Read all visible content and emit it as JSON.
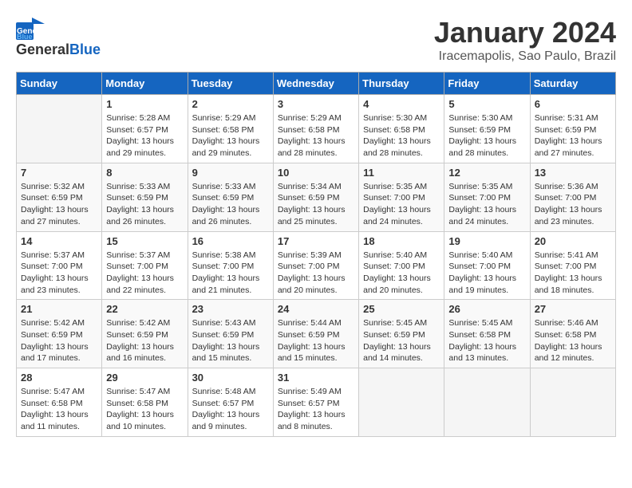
{
  "header": {
    "logo_general": "General",
    "logo_blue": "Blue",
    "month": "January 2024",
    "location": "Iracemapolis, Sao Paulo, Brazil"
  },
  "weekdays": [
    "Sunday",
    "Monday",
    "Tuesday",
    "Wednesday",
    "Thursday",
    "Friday",
    "Saturday"
  ],
  "weeks": [
    [
      {
        "day": "",
        "sunrise": "",
        "sunset": "",
        "daylight": ""
      },
      {
        "day": "1",
        "sunrise": "Sunrise: 5:28 AM",
        "sunset": "Sunset: 6:57 PM",
        "daylight": "Daylight: 13 hours and 29 minutes."
      },
      {
        "day": "2",
        "sunrise": "Sunrise: 5:29 AM",
        "sunset": "Sunset: 6:58 PM",
        "daylight": "Daylight: 13 hours and 29 minutes."
      },
      {
        "day": "3",
        "sunrise": "Sunrise: 5:29 AM",
        "sunset": "Sunset: 6:58 PM",
        "daylight": "Daylight: 13 hours and 28 minutes."
      },
      {
        "day": "4",
        "sunrise": "Sunrise: 5:30 AM",
        "sunset": "Sunset: 6:58 PM",
        "daylight": "Daylight: 13 hours and 28 minutes."
      },
      {
        "day": "5",
        "sunrise": "Sunrise: 5:30 AM",
        "sunset": "Sunset: 6:59 PM",
        "daylight": "Daylight: 13 hours and 28 minutes."
      },
      {
        "day": "6",
        "sunrise": "Sunrise: 5:31 AM",
        "sunset": "Sunset: 6:59 PM",
        "daylight": "Daylight: 13 hours and 27 minutes."
      }
    ],
    [
      {
        "day": "7",
        "sunrise": "Sunrise: 5:32 AM",
        "sunset": "Sunset: 6:59 PM",
        "daylight": "Daylight: 13 hours and 27 minutes."
      },
      {
        "day": "8",
        "sunrise": "Sunrise: 5:33 AM",
        "sunset": "Sunset: 6:59 PM",
        "daylight": "Daylight: 13 hours and 26 minutes."
      },
      {
        "day": "9",
        "sunrise": "Sunrise: 5:33 AM",
        "sunset": "Sunset: 6:59 PM",
        "daylight": "Daylight: 13 hours and 26 minutes."
      },
      {
        "day": "10",
        "sunrise": "Sunrise: 5:34 AM",
        "sunset": "Sunset: 6:59 PM",
        "daylight": "Daylight: 13 hours and 25 minutes."
      },
      {
        "day": "11",
        "sunrise": "Sunrise: 5:35 AM",
        "sunset": "Sunset: 7:00 PM",
        "daylight": "Daylight: 13 hours and 24 minutes."
      },
      {
        "day": "12",
        "sunrise": "Sunrise: 5:35 AM",
        "sunset": "Sunset: 7:00 PM",
        "daylight": "Daylight: 13 hours and 24 minutes."
      },
      {
        "day": "13",
        "sunrise": "Sunrise: 5:36 AM",
        "sunset": "Sunset: 7:00 PM",
        "daylight": "Daylight: 13 hours and 23 minutes."
      }
    ],
    [
      {
        "day": "14",
        "sunrise": "Sunrise: 5:37 AM",
        "sunset": "Sunset: 7:00 PM",
        "daylight": "Daylight: 13 hours and 23 minutes."
      },
      {
        "day": "15",
        "sunrise": "Sunrise: 5:37 AM",
        "sunset": "Sunset: 7:00 PM",
        "daylight": "Daylight: 13 hours and 22 minutes."
      },
      {
        "day": "16",
        "sunrise": "Sunrise: 5:38 AM",
        "sunset": "Sunset: 7:00 PM",
        "daylight": "Daylight: 13 hours and 21 minutes."
      },
      {
        "day": "17",
        "sunrise": "Sunrise: 5:39 AM",
        "sunset": "Sunset: 7:00 PM",
        "daylight": "Daylight: 13 hours and 20 minutes."
      },
      {
        "day": "18",
        "sunrise": "Sunrise: 5:40 AM",
        "sunset": "Sunset: 7:00 PM",
        "daylight": "Daylight: 13 hours and 20 minutes."
      },
      {
        "day": "19",
        "sunrise": "Sunrise: 5:40 AM",
        "sunset": "Sunset: 7:00 PM",
        "daylight": "Daylight: 13 hours and 19 minutes."
      },
      {
        "day": "20",
        "sunrise": "Sunrise: 5:41 AM",
        "sunset": "Sunset: 7:00 PM",
        "daylight": "Daylight: 13 hours and 18 minutes."
      }
    ],
    [
      {
        "day": "21",
        "sunrise": "Sunrise: 5:42 AM",
        "sunset": "Sunset: 6:59 PM",
        "daylight": "Daylight: 13 hours and 17 minutes."
      },
      {
        "day": "22",
        "sunrise": "Sunrise: 5:42 AM",
        "sunset": "Sunset: 6:59 PM",
        "daylight": "Daylight: 13 hours and 16 minutes."
      },
      {
        "day": "23",
        "sunrise": "Sunrise: 5:43 AM",
        "sunset": "Sunset: 6:59 PM",
        "daylight": "Daylight: 13 hours and 15 minutes."
      },
      {
        "day": "24",
        "sunrise": "Sunrise: 5:44 AM",
        "sunset": "Sunset: 6:59 PM",
        "daylight": "Daylight: 13 hours and 15 minutes."
      },
      {
        "day": "25",
        "sunrise": "Sunrise: 5:45 AM",
        "sunset": "Sunset: 6:59 PM",
        "daylight": "Daylight: 13 hours and 14 minutes."
      },
      {
        "day": "26",
        "sunrise": "Sunrise: 5:45 AM",
        "sunset": "Sunset: 6:58 PM",
        "daylight": "Daylight: 13 hours and 13 minutes."
      },
      {
        "day": "27",
        "sunrise": "Sunrise: 5:46 AM",
        "sunset": "Sunset: 6:58 PM",
        "daylight": "Daylight: 13 hours and 12 minutes."
      }
    ],
    [
      {
        "day": "28",
        "sunrise": "Sunrise: 5:47 AM",
        "sunset": "Sunset: 6:58 PM",
        "daylight": "Daylight: 13 hours and 11 minutes."
      },
      {
        "day": "29",
        "sunrise": "Sunrise: 5:47 AM",
        "sunset": "Sunset: 6:58 PM",
        "daylight": "Daylight: 13 hours and 10 minutes."
      },
      {
        "day": "30",
        "sunrise": "Sunrise: 5:48 AM",
        "sunset": "Sunset: 6:57 PM",
        "daylight": "Daylight: 13 hours and 9 minutes."
      },
      {
        "day": "31",
        "sunrise": "Sunrise: 5:49 AM",
        "sunset": "Sunset: 6:57 PM",
        "daylight": "Daylight: 13 hours and 8 minutes."
      },
      {
        "day": "",
        "sunrise": "",
        "sunset": "",
        "daylight": ""
      },
      {
        "day": "",
        "sunrise": "",
        "sunset": "",
        "daylight": ""
      },
      {
        "day": "",
        "sunrise": "",
        "sunset": "",
        "daylight": ""
      }
    ]
  ]
}
